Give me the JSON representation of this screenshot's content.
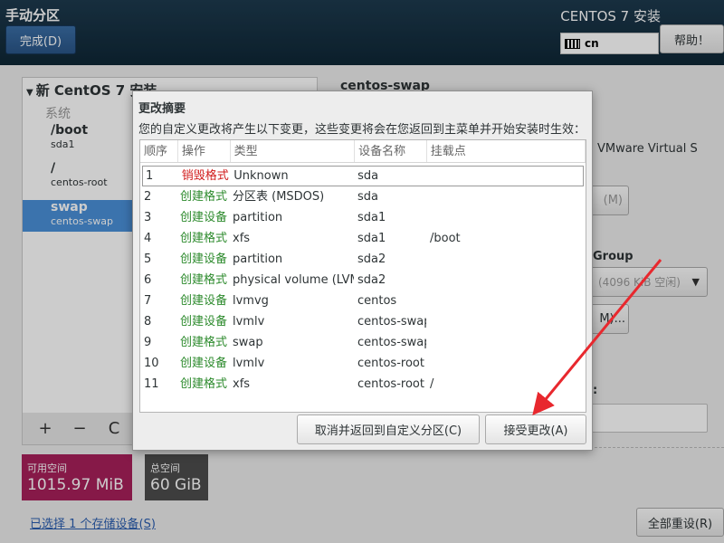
{
  "header": {
    "title": "手动分区",
    "done_label": "完成(D)",
    "product": "CENTOS 7 安装",
    "keyboard_layout": "cn",
    "help_label": "帮助！"
  },
  "left": {
    "group_title": "新 CentOS 7 安装",
    "section_label": "系统",
    "mounts": [
      {
        "name": "/boot",
        "device": "sda1"
      },
      {
        "name": "/",
        "device": "centos-root"
      },
      {
        "name": "swap",
        "device": "centos-swap"
      }
    ],
    "toolbar": {
      "add": "+",
      "remove": "−",
      "refresh": "C"
    }
  },
  "space": {
    "available_label": "可用空间",
    "available_value": "1015.97 MiB",
    "total_label": "总空间",
    "total_value": "60 GiB"
  },
  "storage_link": "已选择 1 个存储设备(S)",
  "reset_label": "全部重设(R)",
  "detail": {
    "title": "centos-swap",
    "device": "VMware Virtual S",
    "modify_label": "(M)",
    "vg_label": "Group",
    "vg_value": "(4096 KiB 空闲)",
    "vg_modify_label": "M)...",
    "label_colon": ":"
  },
  "dialog": {
    "title": "更改摘要",
    "description": "您的自定义更改将产生以下变更，这些变更将会在您返回到主菜单并开始安装时生效：",
    "columns": [
      "顺序",
      "操作",
      "类型",
      "设备名称",
      "挂载点"
    ],
    "rows": [
      {
        "order": "1",
        "action": "销毁格式",
        "kind": "destroy",
        "type": "Unknown",
        "device": "sda",
        "mount": ""
      },
      {
        "order": "2",
        "action": "创建格式",
        "kind": "create",
        "type": "分区表 (MSDOS)",
        "device": "sda",
        "mount": ""
      },
      {
        "order": "3",
        "action": "创建设备",
        "kind": "create",
        "type": "partition",
        "device": "sda1",
        "mount": ""
      },
      {
        "order": "4",
        "action": "创建格式",
        "kind": "create",
        "type": "xfs",
        "device": "sda1",
        "mount": "/boot"
      },
      {
        "order": "5",
        "action": "创建设备",
        "kind": "create",
        "type": "partition",
        "device": "sda2",
        "mount": ""
      },
      {
        "order": "6",
        "action": "创建格式",
        "kind": "create",
        "type": "physical volume (LVM)",
        "device": "sda2",
        "mount": ""
      },
      {
        "order": "7",
        "action": "创建设备",
        "kind": "create",
        "type": "lvmvg",
        "device": "centos",
        "mount": ""
      },
      {
        "order": "8",
        "action": "创建设备",
        "kind": "create",
        "type": "lvmlv",
        "device": "centos-swap",
        "mount": ""
      },
      {
        "order": "9",
        "action": "创建格式",
        "kind": "create",
        "type": "swap",
        "device": "centos-swap",
        "mount": ""
      },
      {
        "order": "10",
        "action": "创建设备",
        "kind": "create",
        "type": "lvmlv",
        "device": "centos-root",
        "mount": ""
      },
      {
        "order": "11",
        "action": "创建格式",
        "kind": "create",
        "type": "xfs",
        "device": "centos-root",
        "mount": "/"
      }
    ],
    "cancel_label": "取消并返回到自定义分区(C)",
    "accept_label": "接受更改(A)"
  },
  "colors": {
    "destroy": "#d11b1b",
    "create": "#2c8a2c",
    "arrow": "#e8282e",
    "accent": "#4a90d9"
  }
}
